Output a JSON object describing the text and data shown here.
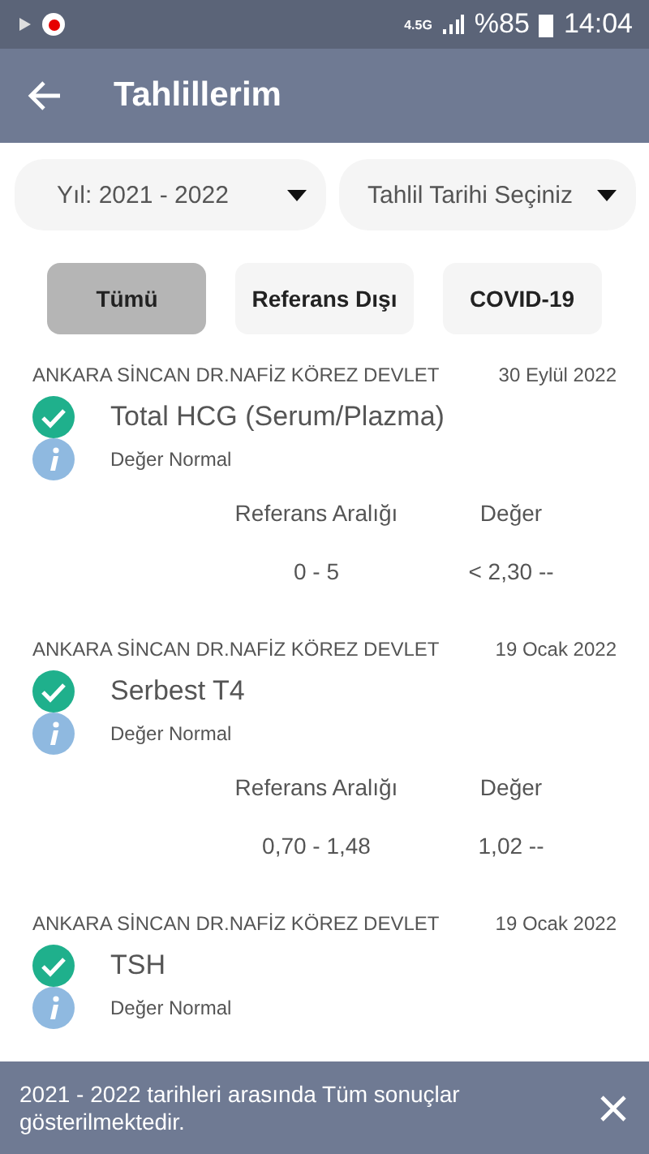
{
  "status_bar": {
    "network": "4.5G",
    "battery": "%85",
    "time": "14:04"
  },
  "app_bar": {
    "title": "Tahlillerim"
  },
  "filters": [
    {
      "label": "Yıl: 2021 - 2022"
    },
    {
      "label": "Tahlil Tarihi Seçiniz"
    }
  ],
  "chips": [
    {
      "label": "Tümü",
      "selected": true
    },
    {
      "label": "Referans Dışı",
      "selected": false
    },
    {
      "label": "COVID-19",
      "selected": false
    }
  ],
  "results": [
    {
      "hospital": "ANKARA SİNCAN  DR.NAFİZ KÖREZ DEVLET",
      "date": "30 Eylül 2022",
      "test": "Total HCG (Serum/Plazma)",
      "status": "Değer Normal",
      "range_label": "Referans Aralığı",
      "value_label": "Değer",
      "range": "0 - 5",
      "value": "< 2,30 --"
    },
    {
      "hospital": "ANKARA SİNCAN  DR.NAFİZ KÖREZ DEVLET",
      "date": "19 Ocak 2022",
      "test": "Serbest T4",
      "status": "Değer Normal",
      "range_label": "Referans Aralığı",
      "value_label": "Değer",
      "range": "0,70 - 1,48",
      "value": "1,02 --"
    },
    {
      "hospital": "ANKARA SİNCAN  DR.NAFİZ KÖREZ DEVLET",
      "date": "19 Ocak 2022",
      "test": "TSH",
      "status": "Değer Normal"
    }
  ],
  "snackbar": {
    "message": "2021 - 2022 tarihleri arasında Tüm sonuçlar gösterilmektedir."
  }
}
